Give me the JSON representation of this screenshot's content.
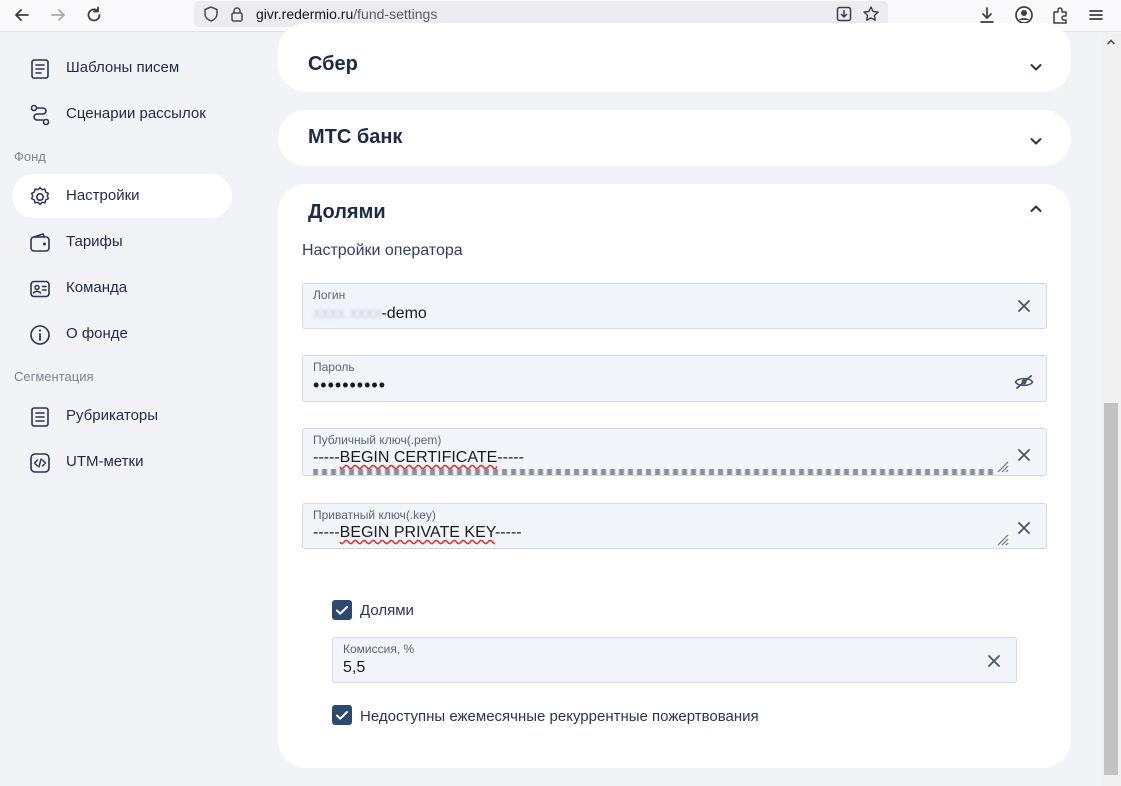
{
  "browser": {
    "url_host": "givr.redermio.ru",
    "url_path": "/fund-settings"
  },
  "sidebar": {
    "items_top": [
      {
        "label": "Шаблоны писем",
        "icon": "template-icon"
      },
      {
        "label": "Сценарии рассылок",
        "icon": "route-icon"
      }
    ],
    "section_fund": "Фонд",
    "items_fund": [
      {
        "label": "Настройки",
        "icon": "gear-icon",
        "active": true
      },
      {
        "label": "Тарифы",
        "icon": "wallet-icon"
      },
      {
        "label": "Команда",
        "icon": "id-card-icon"
      },
      {
        "label": "О фонде",
        "icon": "info-icon"
      }
    ],
    "section_segmentation": "Сегментация",
    "items_seg": [
      {
        "label": "Рубрикаторы",
        "icon": "list-icon"
      },
      {
        "label": "UTM-метки",
        "icon": "code-icon"
      }
    ]
  },
  "cards": {
    "sber": {
      "title": "Сбер"
    },
    "mts": {
      "title": "МТС банк"
    },
    "dolyami": {
      "title": "Долями",
      "operator_heading": "Настройки оператора",
      "login": {
        "label": "Логин",
        "value_suffix": "-demo"
      },
      "password": {
        "label": "Пароль",
        "value": "••••••••••"
      },
      "public_key": {
        "label": "Публичный ключ(.pem)",
        "prefix": "-----",
        "word": "BEGIN CERTIFICATE",
        "suffix": "-----"
      },
      "private_key": {
        "label": "Приватный ключ(.key)",
        "prefix": "-----",
        "word": "BEGIN PRIVATE KEY",
        "suffix": "-----"
      },
      "enable_checkbox": {
        "label": "Долями",
        "checked": true
      },
      "commission": {
        "label": "Комиссия, %",
        "value": "5,5"
      },
      "recurring_checkbox": {
        "label": "Недоступны ежемесячные рекуррентные пожертвования",
        "checked": true
      }
    }
  },
  "colors": {
    "accent": "#2e4970",
    "card_bg": "#ffffff",
    "page_bg": "#f2f3f7"
  }
}
